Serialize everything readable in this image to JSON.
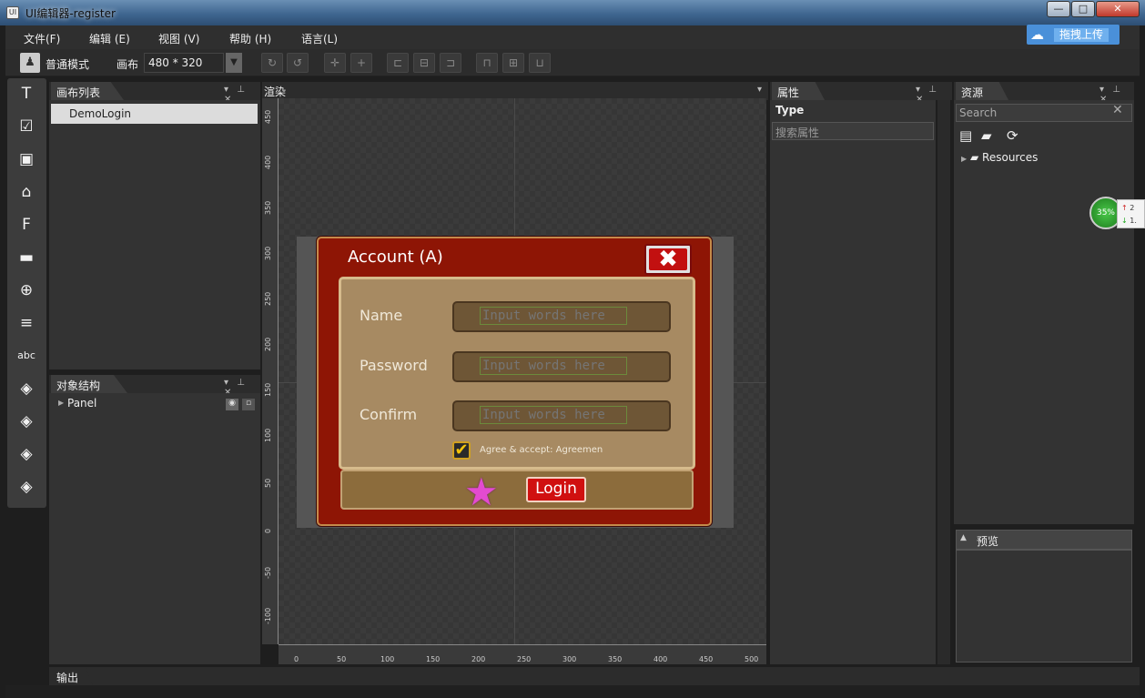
{
  "window": {
    "title": "UI编辑器-register",
    "app_icon": "UI",
    "buttons": {
      "minimize": "—",
      "maximize": "□",
      "close": "✕"
    }
  },
  "menu": {
    "items": [
      "文件(F)",
      "编辑 (E)",
      "视图 (V)",
      "帮助 (H)",
      "语言(L)"
    ]
  },
  "upload": {
    "label": "拖拽上传",
    "icon": "cloud-share-icon"
  },
  "toolbar": {
    "mode_label": "普通模式",
    "canvas_label": "画布",
    "canvas_size": "480 * 320",
    "dropdown_glyph": "▼"
  },
  "tools": [
    "T",
    "☑",
    "▣",
    "⌂",
    "F",
    "▬",
    "⊕",
    "≡",
    "abc",
    "◈",
    "◈",
    "◈",
    "◈"
  ],
  "canvas_list": {
    "title": "画布列表",
    "items": [
      "DemoLogin"
    ]
  },
  "object_tree": {
    "title": "对象结构",
    "items": [
      "Panel"
    ]
  },
  "render": {
    "title": "渲染",
    "y_ticks": [
      "450",
      "400",
      "350",
      "300",
      "250",
      "200",
      "150",
      "100",
      "50",
      "0",
      "-50",
      "-100"
    ],
    "x_ticks": [
      "0",
      "50",
      "100",
      "150",
      "200",
      "250",
      "300",
      "350",
      "400",
      "450",
      "500"
    ]
  },
  "dialog": {
    "title": "Account (A)",
    "close_glyph": "✖",
    "fields": [
      {
        "label": "Name",
        "placeholder": "Input words here"
      },
      {
        "label": "Password",
        "placeholder": "Input words here"
      },
      {
        "label": "Confirm",
        "placeholder": "Input words here"
      }
    ],
    "agree_check": "✔",
    "agree_text": "Agree & accept: Agreemen",
    "star": "★",
    "login_label": "Login"
  },
  "properties": {
    "title": "属性",
    "type_label": "Type",
    "search_placeholder": "搜索属性"
  },
  "resources": {
    "title": "资源",
    "search_placeholder": "Search",
    "tree_root": "Resources"
  },
  "preview": {
    "title": "预览"
  },
  "output": {
    "title": "输出"
  },
  "net_widget": {
    "percent": "35%",
    "up": "2",
    "down": "1."
  },
  "colors": {
    "dialog_red": "#8e1505",
    "form_tan": "#a78a62",
    "login_red": "#d01010",
    "accent_blue": "#4a90d9"
  }
}
